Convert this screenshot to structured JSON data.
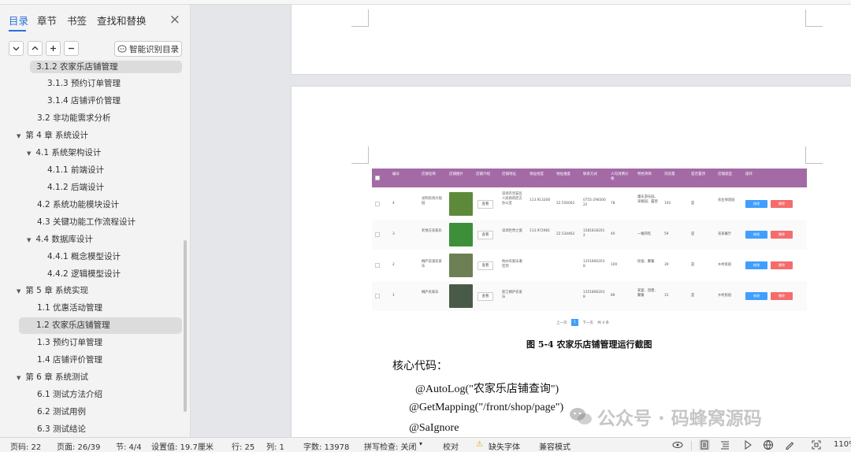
{
  "nav_tabs": [
    "目录",
    "章节",
    "书签",
    "查找和替换"
  ],
  "close_glyph": "×",
  "controls": {
    "smart_toc_label": "智能识别目录"
  },
  "toc": [
    {
      "label": "3.1.2  农家乐店铺管理"
    },
    {
      "label": "3.1.3  预约订单管理"
    },
    {
      "label": "3.1.4  店铺评价管理"
    },
    {
      "label": "3.2  非功能需求分析"
    },
    {
      "label": "第 4 章  系统设计",
      "caret": "▼"
    },
    {
      "label": "4.1  系统架构设计",
      "caret": "▼"
    },
    {
      "label": "4.1.1  前端设计"
    },
    {
      "label": "4.1.2  后端设计"
    },
    {
      "label": "4.2  系统功能模块设计"
    },
    {
      "label": "4.3  关键功能工作流程设计"
    },
    {
      "label": "4.4  数据库设计",
      "caret": "▼"
    },
    {
      "label": "4.4.1  概念模型设计"
    },
    {
      "label": "4.4.2  逻辑模型设计"
    },
    {
      "label": "第 5 章  系统实现",
      "caret": "▼"
    },
    {
      "label": "1.1 优惠活动管理"
    },
    {
      "label": "1.2 农家乐店铺管理",
      "selected": true
    },
    {
      "label": "1.3 预约订单管理"
    },
    {
      "label": "1.4 店铺评价管理"
    },
    {
      "label": "第 6 章  系统测试",
      "caret": "▼"
    },
    {
      "label": "6.1  测试方法介绍"
    },
    {
      "label": "6.2  测试用例"
    },
    {
      "label": "6.3  测试结论"
    }
  ],
  "table": {
    "headers": [
      "编号",
      "店铺名称",
      "店铺图片",
      "店铺介绍",
      "店铺地址",
      "地址经度",
      "地址维度",
      "联系方式",
      "人均消费价格",
      "特色项目",
      "浏览量",
      "是否置顶",
      "店铺类型",
      "操作"
    ],
    "rows": [
      {
        "id": "4",
        "name": "光明农场大观园",
        "view": "查看",
        "addr": "深圳市宝安区人民政府后方办公室",
        "lng": "113.913208",
        "lat": "22.556062",
        "phone": "0755-29830022",
        "price": "78",
        "feature": "康乐游乐园、采摘园、露营",
        "views": "192",
        "top": "是",
        "type": "农业体验园",
        "thumb_color": "#5d8a3a"
      },
      {
        "id": "3",
        "name": "老地方农家乐",
        "view": "查看",
        "addr": "深圳世界之窗",
        "lng": "113.972981",
        "lat": "22.534462",
        "phone": "15818182012",
        "price": "40",
        "feature": "一桶四吃",
        "views": "59",
        "top": "是",
        "type": "农家餐厅",
        "thumb_color": "#3e8f3a"
      },
      {
        "id": "2",
        "name": "桐庐荻浦农家乐",
        "view": "查看",
        "addr": "杭州农家乐邀您到",
        "lng": "",
        "lat": "",
        "phone": "13518062038",
        "price": "100",
        "feature": "民宿、聚餐",
        "views": "39",
        "top": "是",
        "type": "乡村民宿",
        "thumb_color": "#6d7f55"
      },
      {
        "id": "1",
        "name": "桐庐农家乐",
        "view": "查看",
        "addr": "浙江桐庐农家乐",
        "lng": "",
        "lat": "",
        "phone": "13518062038",
        "price": "89",
        "feature": "家宴、团建、聚餐",
        "views": "15",
        "top": "是",
        "type": "乡村民宿",
        "thumb_color": "#4a5a48"
      }
    ],
    "edit_label": "修改",
    "delete_label": "删除",
    "pager": {
      "prev": "上一页",
      "current": "1",
      "next": "下一页",
      "total": "共 4 条"
    }
  },
  "caption": "图 5-4  农家乐店铺管理运行截图",
  "code_lines": [
    "核心代码：",
    "@AutoLog(\"农家乐店铺查询\")",
    "@GetMapping(\"/front/shop/page\")",
    "@SaIgnore"
  ],
  "watermark": "公众号 · 码蜂窝源码",
  "status": {
    "page_no": "页码: 22",
    "page_of": "页面: 26/39",
    "section": "节: 4/4",
    "setting": "设置值: 19.7厘米",
    "line": "行: 25",
    "col": "列: 1",
    "words": "字数: 13978",
    "spell": "拼写检查: 关闭",
    "proof": "校对",
    "missing_font": "缺失字体",
    "compat": "兼容模式",
    "zoom": "110%"
  }
}
